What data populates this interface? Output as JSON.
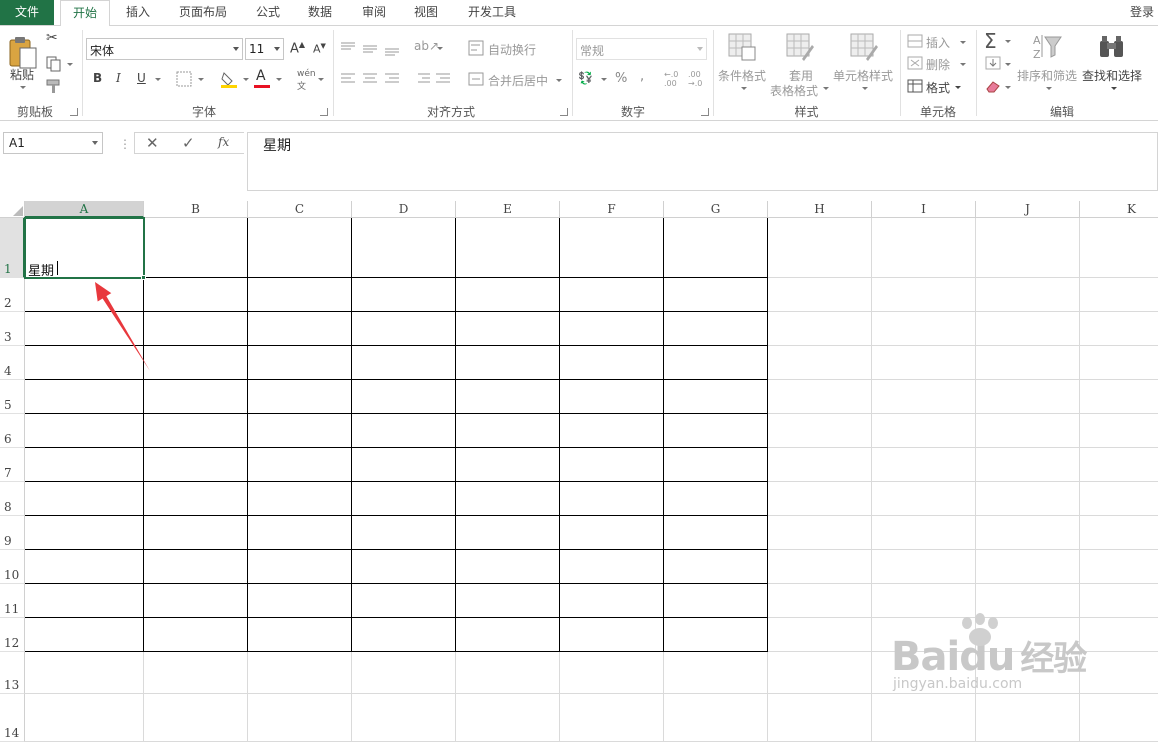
{
  "ribbon_tabs": [
    "文件",
    "开始",
    "插入",
    "页面布局",
    "公式",
    "数据",
    "审阅",
    "视图",
    "开发工具"
  ],
  "active_tab": "开始",
  "login": "登录",
  "clipboard": {
    "paste": "粘贴",
    "group": "剪贴板"
  },
  "font": {
    "name": "宋体",
    "size": "11",
    "group": "字体",
    "bold": "B",
    "italic": "I",
    "underline": "U"
  },
  "alignment": {
    "wrap": "自动换行",
    "merge": "合并后居中",
    "group": "对齐方式"
  },
  "number": {
    "format": "常规",
    "percent": "%",
    "comma": ",",
    "group": "数字"
  },
  "styles": {
    "conditional": "条件格式",
    "table_format_l1": "套用",
    "table_format_l2": "表格格式",
    "cell_styles": "单元格样式",
    "group": "样式"
  },
  "cells": {
    "insert": "插入",
    "delete": "删除",
    "format": "格式",
    "group": "单元格"
  },
  "editing": {
    "sum": "Σ",
    "sort": "排序和筛选",
    "find": "查找和选择",
    "group": "编辑"
  },
  "formula_bar": {
    "name_box": "A1",
    "fx": "fx",
    "content": "星期"
  },
  "sheet": {
    "columns": [
      "A",
      "B",
      "C",
      "D",
      "E",
      "F",
      "G",
      "H",
      "I",
      "J",
      "K"
    ],
    "rows": [
      "1",
      "2",
      "3",
      "4",
      "5",
      "6",
      "7",
      "8",
      "9",
      "10",
      "11",
      "12",
      "13",
      "14"
    ],
    "active_cell": "A1",
    "a1_value": "星期"
  },
  "watermark": {
    "brand": "Baidu",
    "cn": "经验",
    "url": "jingyan.baidu.com"
  },
  "colors": {
    "accent": "#217346",
    "arrow": "#e8383d"
  }
}
